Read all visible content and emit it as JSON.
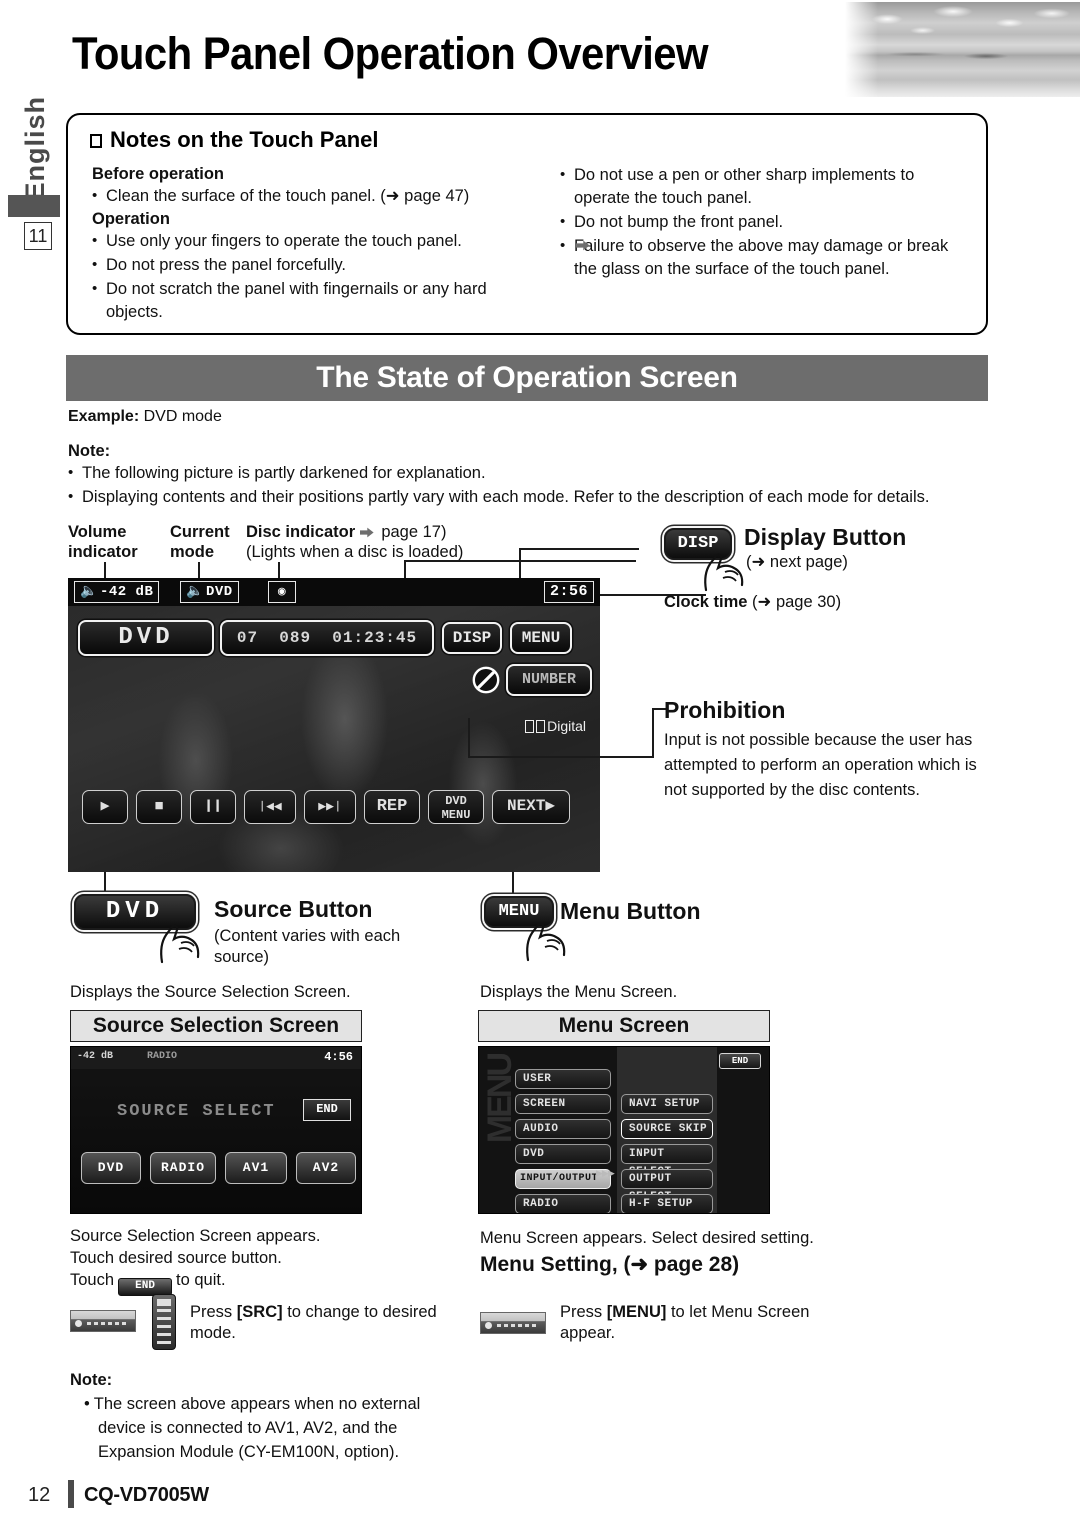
{
  "header": {
    "title": "Touch Panel Operation Overview",
    "language_tab": "English",
    "section_number": "11"
  },
  "notes_box": {
    "heading": "Notes on the Touch Panel",
    "before_operation_heading": "Before operation",
    "before_operation_items": [
      "Clean the surface of the touch panel. (➜ page 47)"
    ],
    "operation_heading": "Operation",
    "operation_items": [
      "Use only your fingers to operate the touch panel.",
      "Do not press the panel forcefully.",
      "Do not scratch the panel with fingernails or any hard objects."
    ],
    "right_items": [
      "Do not use a pen or other sharp implements to operate the touch panel.",
      "Do not bump the front panel."
    ],
    "right_sub_item": "Failure to observe the above may damage or break the glass on the surface of the touch panel."
  },
  "section": {
    "banner_title": "The State of Operation Screen",
    "example_label": "Example:",
    "example_value": "DVD mode",
    "note_label": "Note:",
    "notes": [
      "The following picture is partly darkened for explanation.",
      "Displaying contents and their positions partly vary with each mode. Refer to the description of each mode for details."
    ]
  },
  "callouts": {
    "volume_indicator": "Volume\nindicator",
    "volume_indicator_l1": "Volume",
    "volume_indicator_l2": "indicator",
    "current_mode_l1": "Current",
    "current_mode_l2": "mode",
    "disc_indicator": "Disc indicator",
    "disc_indicator_ref": "(➜ page 17)",
    "disc_indicator_note": "(Lights when a disc is loaded)",
    "display_button_title": "Display Button",
    "display_button_ref": "(➜ next page)",
    "clock_time_title": "Clock time",
    "clock_time_ref": "(➜ page 30)",
    "prohibition_title": "Prohibition",
    "prohibition_text": "Input is not possible because the user has attempted to perform an operation which is not supported by the disc contents."
  },
  "dvd_screen": {
    "volume": "-42 dB",
    "mode": "DVD",
    "disc_icon": "disc-icon",
    "clock": "2:56",
    "source_button": "DVD",
    "track_info": "07   089  01:23:45",
    "track_number": "07",
    "chapter_number": "089",
    "elapsed_time": "01:23:45",
    "disp_button": "DISP",
    "menu_button": "MENU",
    "number_button": "NUMBER",
    "prohibition_icon": "prohibition-icon",
    "audio_format": "Digital",
    "controls": [
      {
        "name": "play",
        "label": "▶"
      },
      {
        "name": "stop",
        "label": "■"
      },
      {
        "name": "pause",
        "label": "❙❙"
      },
      {
        "name": "previous",
        "label": "❘◀◀"
      },
      {
        "name": "next",
        "label": "▶▶❘"
      },
      {
        "name": "repeat",
        "label": "REP"
      },
      {
        "name": "dvd-menu",
        "label": "DVD\nMENU"
      },
      {
        "name": "next-page",
        "label": "NEXT▶"
      }
    ],
    "dvd_menu_l1": "DVD",
    "dvd_menu_l2": "MENU",
    "next_label": "NEXT▶"
  },
  "source_button_block": {
    "button_label": "DVD",
    "title": "Source Button",
    "subtitle": "(Content varies with each source)",
    "description": "Displays the Source Selection Screen.",
    "screen_banner": "Source Selection Screen",
    "screen": {
      "volume": "-42 dB",
      "mode": "RADIO",
      "clock": "4:56",
      "title": "SOURCE SELECT",
      "end_label": "END",
      "buttons": [
        "DVD",
        "RADIO",
        "AV1",
        "AV2"
      ]
    },
    "after_lines": [
      "Source Selection Screen appears.",
      "Touch desired source button."
    ],
    "touch_prefix": "Touch",
    "touch_end_label": "END",
    "touch_suffix": "to quit.",
    "hw_instruction_pre": "Press",
    "hw_instruction_key": "[SRC]",
    "hw_instruction_post": "to change to desired mode.",
    "note_label": "Note:",
    "note_text": "The screen above appears when no external device is connected to AV1, AV2, and the Expansion Module (CY-EM100N, option)."
  },
  "menu_button_block": {
    "button_label": "MENU",
    "title": "Menu Button",
    "description": "Displays the Menu Screen.",
    "screen_banner": "Menu Screen",
    "screen": {
      "watermark": "MENU",
      "end_label": "END",
      "left_items": [
        "USER",
        "SCREEN",
        "AUDIO",
        "DVD",
        "INPUT/OUTPUT",
        "RADIO"
      ],
      "left_selected_index": 4,
      "right_items": [
        "NAVI SETUP",
        "SOURCE SKIP",
        "INPUT SELECT",
        "OUTPUT SELECT",
        "H-F SETUP"
      ],
      "right_highlight_index": 1,
      "arrows": "▶▶▶"
    },
    "after_line": "Menu Screen appears. Select desired setting.",
    "setting_title": "Menu Setting, (➜ page 28)",
    "hw_instruction_pre": "Press",
    "hw_instruction_key": "[MENU]",
    "hw_instruction_post": "to let Menu Screen appear."
  },
  "footer": {
    "page_number": "12",
    "model": "CQ-VD7005W"
  }
}
